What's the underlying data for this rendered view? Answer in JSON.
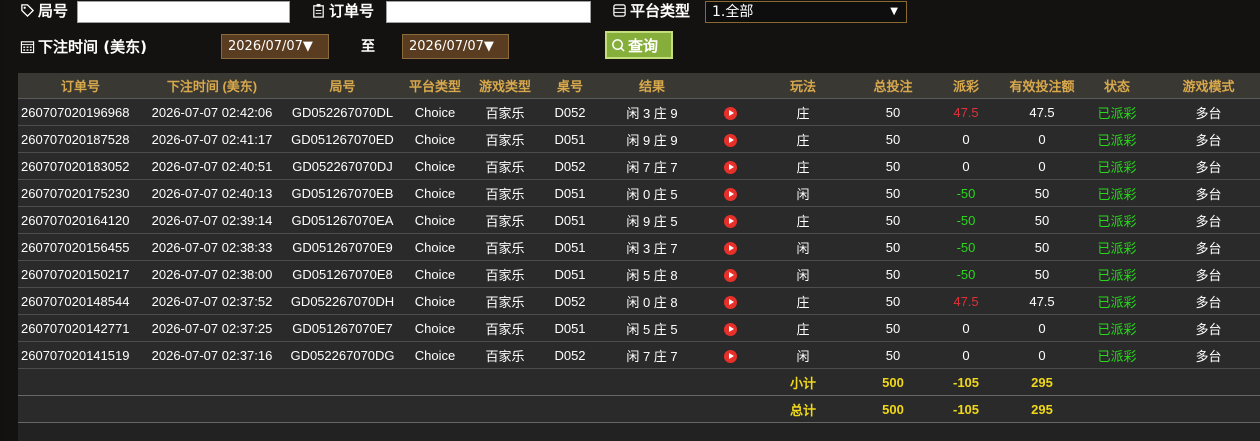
{
  "filters": {
    "ju_label": "局号",
    "order_label": "订单号",
    "platform_label": "平台类型",
    "platform_value": "1.全部",
    "time_label": "下注时间 (美东)",
    "date_from": "2026/07/07▼",
    "to_label": "至",
    "date_to": "2026/07/07▼",
    "query_label": "查询"
  },
  "table": {
    "headers": [
      "订单号",
      "下注时间 (美东)",
      "局号",
      "平台类型",
      "游戏类型",
      "桌号",
      "结果",
      "",
      "玩法",
      "总投注",
      "派彩",
      "有效投注额",
      "状态",
      "游戏模式"
    ],
    "rows": [
      [
        "260707020196968",
        "2026-07-07 02:42:06",
        "GD052267070DL",
        "Choice",
        "百家乐",
        "D052",
        "闲 3 庄 9",
        "",
        "庄",
        "50",
        "47.5",
        "47.5",
        "已派彩",
        "多台"
      ],
      [
        "260707020187528",
        "2026-07-07 02:41:17",
        "GD051267070ED",
        "Choice",
        "百家乐",
        "D051",
        "闲 9 庄 9",
        "",
        "庄",
        "50",
        "0",
        "0",
        "已派彩",
        "多台"
      ],
      [
        "260707020183052",
        "2026-07-07 02:40:51",
        "GD052267070DJ",
        "Choice",
        "百家乐",
        "D052",
        "闲 7 庄 7",
        "",
        "庄",
        "50",
        "0",
        "0",
        "已派彩",
        "多台"
      ],
      [
        "260707020175230",
        "2026-07-07 02:40:13",
        "GD051267070EB",
        "Choice",
        "百家乐",
        "D051",
        "闲 0 庄 5",
        "",
        "闲",
        "50",
        "-50",
        "50",
        "已派彩",
        "多台"
      ],
      [
        "260707020164120",
        "2026-07-07 02:39:14",
        "GD051267070EA",
        "Choice",
        "百家乐",
        "D051",
        "闲 9 庄 5",
        "",
        "庄",
        "50",
        "-50",
        "50",
        "已派彩",
        "多台"
      ],
      [
        "260707020156455",
        "2026-07-07 02:38:33",
        "GD051267070E9",
        "Choice",
        "百家乐",
        "D051",
        "闲 3 庄 7",
        "",
        "闲",
        "50",
        "-50",
        "50",
        "已派彩",
        "多台"
      ],
      [
        "260707020150217",
        "2026-07-07 02:38:00",
        "GD051267070E8",
        "Choice",
        "百家乐",
        "D051",
        "闲 5 庄 8",
        "",
        "闲",
        "50",
        "-50",
        "50",
        "已派彩",
        "多台"
      ],
      [
        "260707020148544",
        "2026-07-07 02:37:52",
        "GD052267070DH",
        "Choice",
        "百家乐",
        "D052",
        "闲 0 庄 8",
        "",
        "庄",
        "50",
        "47.5",
        "47.5",
        "已派彩",
        "多台"
      ],
      [
        "260707020142771",
        "2026-07-07 02:37:25",
        "GD051267070E7",
        "Choice",
        "百家乐",
        "D051",
        "闲 5 庄 5",
        "",
        "庄",
        "50",
        "0",
        "0",
        "已派彩",
        "多台"
      ],
      [
        "260707020141519",
        "2026-07-07 02:37:16",
        "GD052267070DG",
        "Choice",
        "百家乐",
        "D052",
        "闲 7 庄 7",
        "",
        "闲",
        "50",
        "0",
        "0",
        "已派彩",
        "多台"
      ]
    ],
    "subtotal": {
      "label": "小计",
      "total_bet": "500",
      "payout": "-105",
      "valid_bet": "295"
    },
    "total": {
      "label": "总计",
      "total_bet": "500",
      "payout": "-105",
      "valid_bet": "295"
    }
  },
  "colors": {
    "header_text": "#d8a84c",
    "win": "#e0303a",
    "loss": "#27d81b",
    "status": "#27d81b",
    "summary": "#f0d81a"
  },
  "icons": {
    "ju": "tag-icon",
    "order": "clipboard-icon",
    "platform": "list-icon",
    "time": "calendar-icon",
    "query": "search-icon",
    "replay": "play-icon"
  }
}
